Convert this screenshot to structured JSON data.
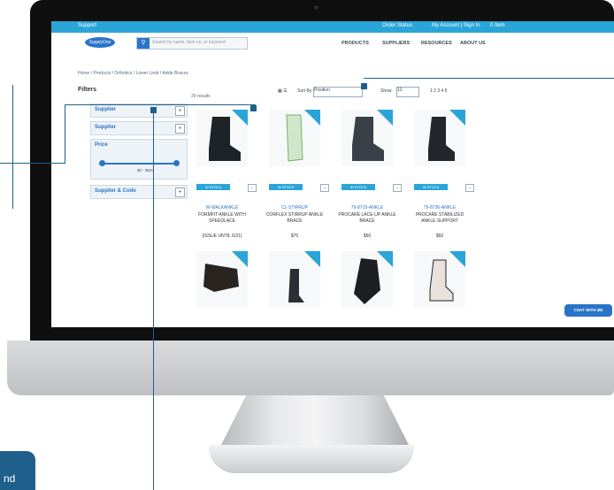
{
  "topbar": {
    "left_text": "Support",
    "right_items": [
      "Order Status",
      "My Account | Sign In",
      "0 Item"
    ]
  },
  "site": {
    "logo_text": "SupplyOne",
    "search_placeholder": "Search by name, item no. or keyword",
    "nav": [
      "PRODUCTS",
      "SUPPLIERS",
      "RESOURCES",
      "ABOUT US"
    ]
  },
  "breadcrumb": "Home  /  Products  /  Orthotics  /  Lower Limb  /  Ankle Braces",
  "filters": {
    "title": "Filters",
    "items": [
      "Supplier",
      "Supplier",
      "Price",
      "Supplier & Code"
    ],
    "price_range": "$0 - $500"
  },
  "results_text": "20 results",
  "sort": {
    "label": "Sort By",
    "value": "Position",
    "show_label": "Show",
    "show_value": "12",
    "pages": "1  2  3  4  5"
  },
  "products": [
    {
      "code": "W-WALKANKLE",
      "name": "FORMFIT ANKLE WITH SPEEDLACE",
      "price": "(ISSUE UNTIL 6/21)",
      "badge": "IN STOCK"
    },
    {
      "code": "CL-STIRRUP",
      "name": "CORFLEX STIRRUP ANKLE BRACE",
      "price": "$75",
      "badge": "IN STOCK"
    },
    {
      "code": "79-8715-ANKLE",
      "name": "PROCARE LACE-UP ANKLE BRACE",
      "price": "$50",
      "badge": "IN STOCK"
    },
    {
      "code": "79-8736-ANKLE",
      "name": "PROCARE STABILIZED ANKLE SUPPORT",
      "price": "$60",
      "badge": "IN STOCK"
    }
  ],
  "chat_label": "CHAT WITH ME",
  "callout_text": "nd",
  "colors": {
    "brand_blue": "#2aa5d8",
    "accent": "#2a74c8",
    "callout": "#1f5f8b"
  }
}
